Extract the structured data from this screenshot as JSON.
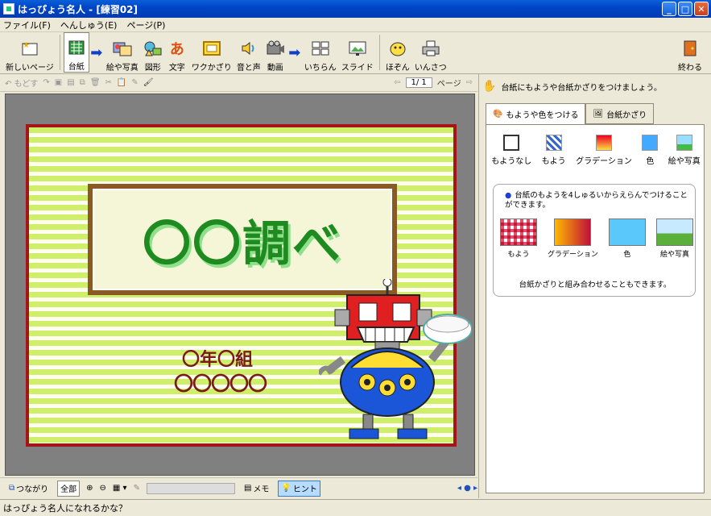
{
  "window": {
    "title": "はっぴょう名人 - [練習02]"
  },
  "menu": [
    "ファイル(F)",
    "へんしゅう(E)",
    "ページ(P)"
  ],
  "toolbar": {
    "new_page": "新しいページ",
    "items": [
      "台紙",
      "絵や写真",
      "図形",
      "文字",
      "ワクかざり",
      "音と声",
      "動画",
      "いちらん",
      "スライド",
      "ほぞん",
      "いんさつ"
    ],
    "exit": "終わる"
  },
  "edit_toolbar": {
    "undo": "もどす",
    "page_indicator": "1/ 1",
    "page_label": "ページ"
  },
  "slide": {
    "title": "〇〇調べ",
    "class_line": "〇年〇組",
    "name_line": "〇〇〇〇〇"
  },
  "bottom_bar": {
    "link": "つながり",
    "zoom_all": "全部",
    "memo": "メモ",
    "hint": "ヒント"
  },
  "status": {
    "text": "はっぴょう名人になれるかな？"
  },
  "right_panel": {
    "instruction": "台紙にもようや台紙かざりをつけましょう。",
    "tabs": [
      "もようや色をつける",
      "台紙かざり"
    ],
    "options": [
      "もようなし",
      "もよう",
      "グラデーション",
      "色",
      "絵や写真"
    ],
    "info_text": "台紙のもようを4しゅるいからえらんでつけることができます。",
    "swatches": [
      "もよう",
      "グラデーション",
      "色",
      "絵や写真"
    ],
    "info_foot": "台紙かざりと組み合わせることもできます。"
  },
  "colors": {
    "accent": "#1e8a20",
    "frame": "#a3141b",
    "stripe": "#cfee6a"
  }
}
